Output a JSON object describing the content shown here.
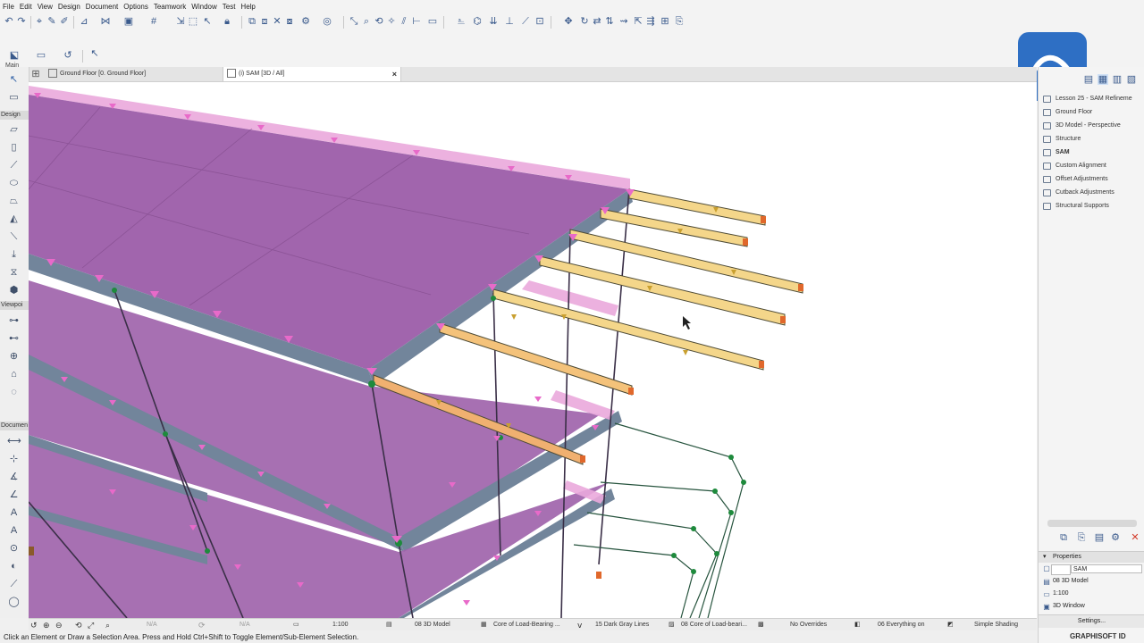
{
  "menu": [
    "File",
    "Edit",
    "View",
    "Design",
    "Document",
    "Options",
    "Teamwork",
    "Window",
    "Test",
    "Help"
  ],
  "toolbar": {
    "palette_label": "Main"
  },
  "tabs": [
    {
      "label": "Ground Floor [0. Ground Floor]"
    },
    {
      "label": "(i) SAM [3D / All]",
      "close": "×"
    }
  ],
  "toolbox": {
    "sections": [
      "Design",
      "Viewpoi",
      "Documen"
    ]
  },
  "navigator": {
    "items": [
      {
        "label": "Lesson 25 - SAM Refineme",
        "icon": "project-icon"
      },
      {
        "label": "Ground Floor",
        "icon": "folder-icon"
      },
      {
        "label": "3D Model - Perspective",
        "icon": "view-icon"
      },
      {
        "label": "Structure",
        "icon": "view-icon"
      },
      {
        "label": "SAM",
        "icon": "view-icon",
        "selected": true
      },
      {
        "label": "Custom Alignment",
        "icon": "view-icon"
      },
      {
        "label": "Offset Adjustments",
        "icon": "view-icon"
      },
      {
        "label": "Cutback Adjustments",
        "icon": "view-icon"
      },
      {
        "label": "Structural Supports",
        "icon": "view-icon"
      }
    ],
    "properties": {
      "header": "Properties",
      "name_value": "SAM",
      "model_view": "08 3D Model",
      "scale": "1:100",
      "window": "3D Window",
      "settings_button": "Settings..."
    },
    "brand": "GRAPHISOFT ID"
  },
  "bottom_bar": {
    "na1": "N/A",
    "na2": "N/A",
    "scale": "1:100",
    "model_view": "08 3D Model",
    "structure": "Core of Load-Bearing ...",
    "pens": "15 Dark Gray Lines",
    "layer": "08 Core of Load-beari...",
    "overrides": "No Overrides",
    "renovation": "06 Everything on",
    "shading": "Simple Shading"
  },
  "status": {
    "text": "Click an Element or Draw a Selection Area. Press and Hold Ctrl+Shift to Toggle Element/Sub-Element Selection."
  },
  "colors": {
    "slab": "#9a5fa6",
    "slab_load": "#e9a6dc",
    "beam_edge": "#6f8399",
    "beam_load": "#f5d98a",
    "node": "#1e8a3c",
    "link_line": "#27543e",
    "accent": "#2e6fc4"
  }
}
